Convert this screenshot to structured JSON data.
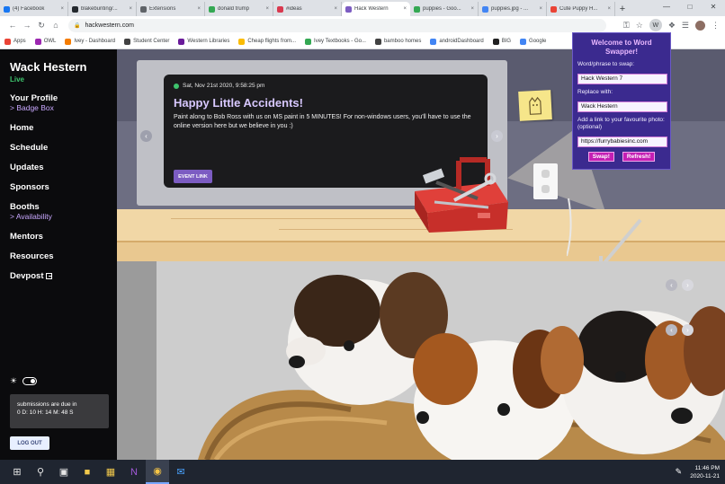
{
  "browser": {
    "tabs": [
      {
        "label": "(4) Facebook",
        "color": "#1877f2",
        "active": false
      },
      {
        "label": "blakebunting/...",
        "color": "#24292e",
        "active": false
      },
      {
        "label": "Extensions",
        "color": "#5f6368",
        "active": false
      },
      {
        "label": "donald trump",
        "color": "#34a853",
        "active": false
      },
      {
        "label": "#ideas",
        "color": "#d9394f",
        "active": false
      },
      {
        "label": "Hack Western",
        "color": "#7c5cc2",
        "active": true
      },
      {
        "label": "puppies - Goo...",
        "color": "#34a853",
        "active": false
      },
      {
        "label": "puppies.jpg - ...",
        "color": "#4285f4",
        "active": false
      },
      {
        "label": "Cute Puppy H...",
        "color": "#ea4335",
        "active": false
      }
    ],
    "new_tab": "+",
    "url": "hackwestern.com",
    "bookmarks": [
      {
        "label": "Apps",
        "color": "#ea4335"
      },
      {
        "label": "OWL",
        "color": "#9c27b0"
      },
      {
        "label": "Ivey - Dashboard",
        "color": "#f57c00"
      },
      {
        "label": "Student Center",
        "color": "#424242"
      },
      {
        "label": "Western Libraries",
        "color": "#6a1b9a"
      },
      {
        "label": "Cheap flights from...",
        "color": "#fbbc04"
      },
      {
        "label": "Ivey Textbooks - Go...",
        "color": "#34a853"
      },
      {
        "label": "bamboo homes",
        "color": "#424242"
      },
      {
        "label": "androidDashboard",
        "color": "#4285f4"
      },
      {
        "label": "BIG",
        "color": "#212121"
      },
      {
        "label": "Google",
        "color": "#4285f4"
      }
    ]
  },
  "sidebar": {
    "brand": "Wack Hestern",
    "status": "Live",
    "nav": [
      {
        "label": "Your Profile",
        "sub": "> Badge Box"
      },
      {
        "label": "Home",
        "sub": ""
      },
      {
        "label": "Schedule",
        "sub": ""
      },
      {
        "label": "Updates",
        "sub": ""
      },
      {
        "label": "Sponsors",
        "sub": ""
      },
      {
        "label": "Booths",
        "sub": "> Availability"
      },
      {
        "label": "Mentors",
        "sub": ""
      },
      {
        "label": "Resources",
        "sub": ""
      },
      {
        "label": "Devpost",
        "sub": ""
      }
    ],
    "deadline_line1": "submissions are due in",
    "deadline_line2": "0 D: 10 H: 14 M: 48 S",
    "logout": "LOG OUT"
  },
  "event": {
    "datetime": "Sat, Nov 21st 2020, 9:58:25 pm",
    "title": "Happy Little Accidents!",
    "description": "Paint along to Bob Ross with us on MS paint in 5 MINUTES! For non-windows users, you'll have to use the online version here but we believe in you :)",
    "link_label": "EVENT LINK"
  },
  "popup": {
    "title": "Welcome to Word Swapper!",
    "find_label": "Word/phrase to swap:",
    "find_value": "Hack Western 7",
    "replace_label": "Replace with:",
    "replace_value": "Wack Hestern",
    "photo_label": "Add a link to your favourite photo: (optional)",
    "photo_value": "https://furrybabiesinc.com",
    "swap_button": "Swap!",
    "refresh_button": "Refresh!"
  },
  "taskbar": {
    "time": "11:46 PM",
    "date": "2020-11-21"
  },
  "colors": {
    "accent": "#7c5cc2",
    "live": "#3ec46d",
    "popup_bg": "#3b2a8f",
    "popup_button": "#c41fb4"
  }
}
